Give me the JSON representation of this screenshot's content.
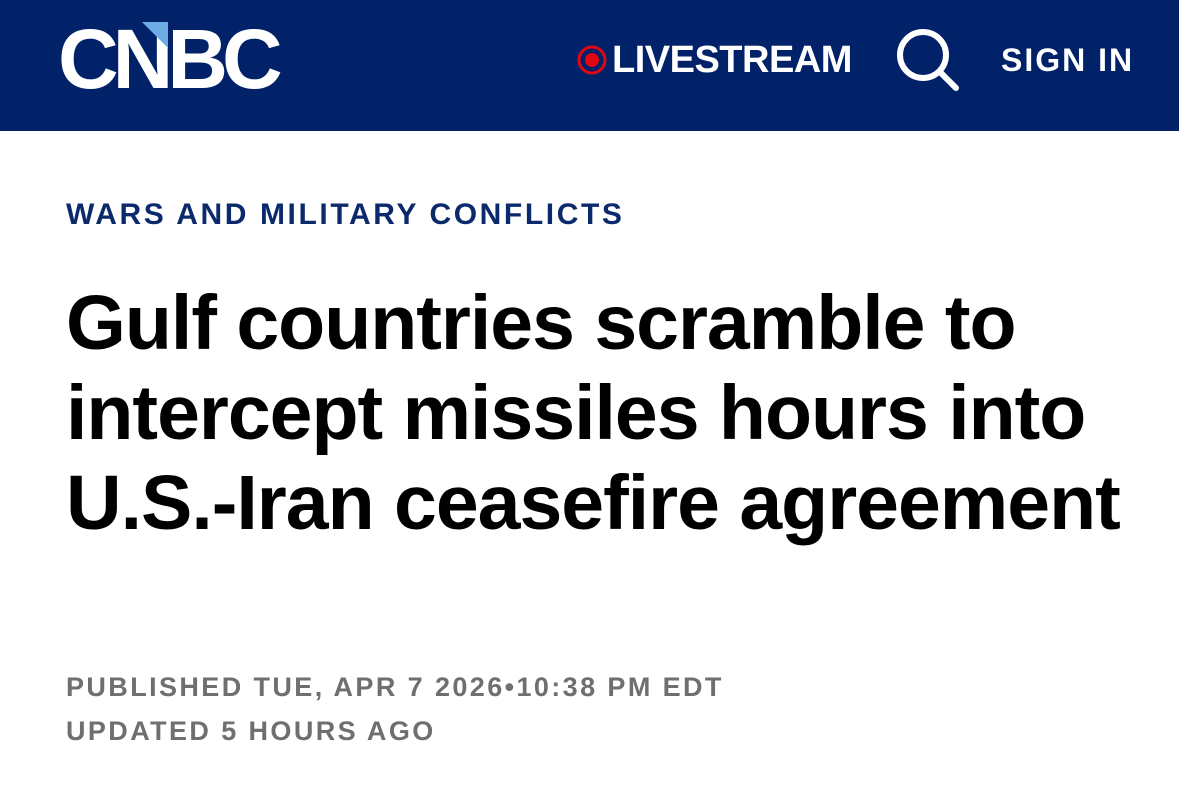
{
  "header": {
    "logo_text": "CNBC",
    "livestream_label": "LIVESTREAM",
    "signin_label": "SIGN IN",
    "icons": {
      "live": "live-dot-icon",
      "search": "search-icon"
    },
    "colors": {
      "nav_bg": "#012169",
      "live_red": "#e30613",
      "text": "#ffffff"
    }
  },
  "article": {
    "category": "WARS AND MILITARY CONFLICTS",
    "headline": "Gulf countries scramble to intercept missiles hours into U.S.-Iran ceasefire agreement",
    "published": "PUBLISHED TUE, APR 7 2026•10:38 PM EDT",
    "updated": "UPDATED 5 HOURS AGO",
    "colors": {
      "category": "#0b2a6b",
      "headline": "#000000",
      "meta": "#6f6f6f"
    }
  }
}
